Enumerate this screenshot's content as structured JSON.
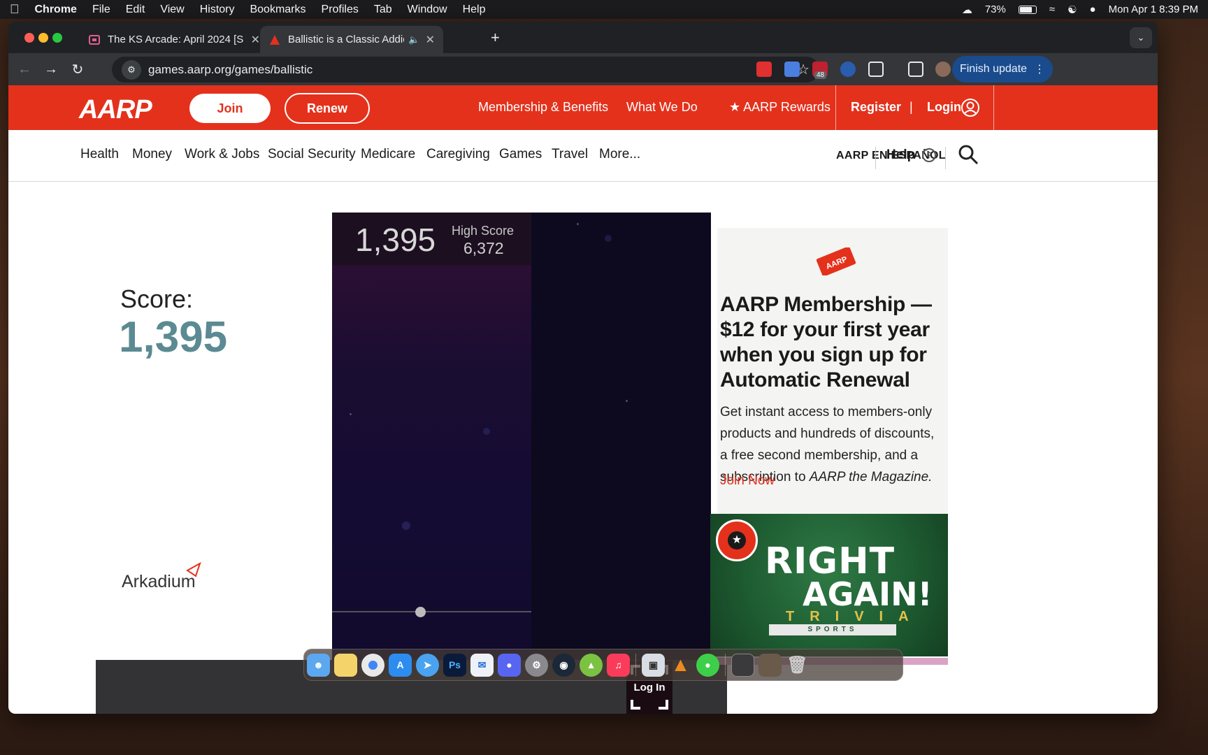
{
  "menubar": {
    "app": "Chrome",
    "items": [
      "File",
      "Edit",
      "View",
      "History",
      "Bookmarks",
      "Profiles",
      "Tab",
      "Window",
      "Help"
    ],
    "battery": "73%",
    "datetime": "Mon Apr 1  8:39 PM"
  },
  "browser": {
    "tabs": [
      {
        "title": "The KS Arcade: April 2024 [S"
      },
      {
        "title": "Ballistic is a Classic Addic"
      }
    ],
    "url": "games.aarp.org/games/ballistic",
    "extension_badge": "48",
    "finish_update": "Finish update"
  },
  "aarp": {
    "logo": "AARP",
    "join": "Join",
    "renew": "Renew",
    "header_links": {
      "membership": "Membership & Benefits",
      "what_we_do": "What We Do",
      "rewards": "★ AARP Rewards",
      "register": "Register",
      "login": "Login"
    },
    "nav": [
      "Health",
      "Money",
      "Work & Jobs",
      "Social Security",
      "Medicare",
      "Caregiving",
      "Games",
      "Travel",
      "More..."
    ],
    "espanol": "AARP EN ESPAÑOL",
    "help": "Help"
  },
  "game": {
    "score_label": "Score:",
    "score": "1,395",
    "high_score_label": "High Score",
    "high_score": "6,372",
    "provider": "Arkadium",
    "login": "Log In"
  },
  "ad": {
    "title": "AARP Membership — $12 for your first year when you sign up for Automatic Renewal",
    "body_prefix": "Get instant access to members-only products and hundreds of discounts, a free second membership, and a subscription to ",
    "body_magazine": "AARP the Magazine.",
    "link": "Join Now"
  },
  "trivia": {
    "line1": "RIGHT",
    "line2": "AGAIN!",
    "line3": "TRIVIA",
    "line4": "SPORTS"
  },
  "colors": {
    "aarp_red": "#e4311c",
    "score_teal": "#5b8a92"
  }
}
